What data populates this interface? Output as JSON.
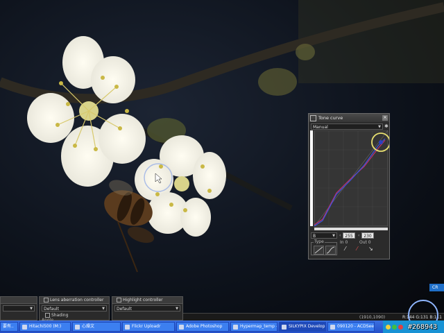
{
  "tone_curve": {
    "title": "Tone curve",
    "preset": "Manual",
    "preset_star": "✱",
    "channel": "B",
    "input_value": "255",
    "output_value": "230",
    "in_label": "In 0",
    "out_label": "Out 0",
    "type_label": "Type"
  },
  "panels": {
    "left": {
      "preset": ""
    },
    "lens": {
      "title": "Lens aberration controller",
      "preset": "Default",
      "shading_label": "Shading",
      "angle_label": "Angle"
    },
    "highlight": {
      "title": "Highlight controller",
      "preset": "Default"
    }
  },
  "status": {
    "coords": "(1910,1090)",
    "rgb": "R:144 G:131 B:111"
  },
  "cr_badge": "CR",
  "taskbar": {
    "items": [
      "要有..",
      "Hitachi500 (M:)",
      "心燥文",
      "Flickr Uploadr",
      "Adobe Photoshop",
      "Hypermap_temp - ...",
      "SILKYPIX Develop...",
      "090120 - ACDSee ..."
    ]
  },
  "watermark": "#268943",
  "colors": {
    "accent_blue": "#2450c9",
    "tray_blue": "#1892d4",
    "highlight_circle": "#e8e070"
  }
}
